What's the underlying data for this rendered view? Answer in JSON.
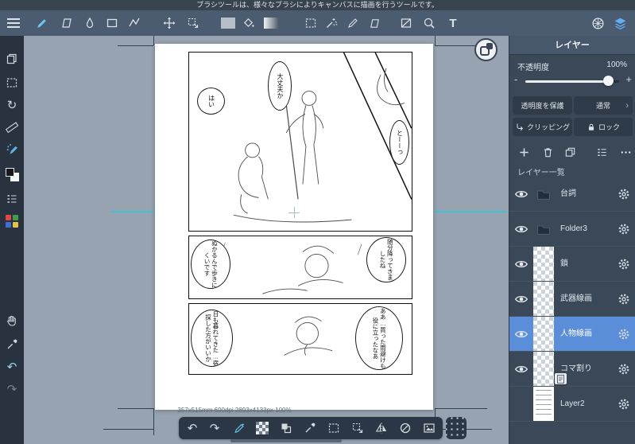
{
  "glyphs": {
    "undo": "↶",
    "redo": "↷",
    "rotate_reset": "↻",
    "chevron": "›",
    "minus": "-",
    "plus": "+",
    "text_tool": "T"
  },
  "notification": {
    "text": "ブラシツールは、様々なブラシによりキャンバスに描画を行うツールです。"
  },
  "top_toolbar": {
    "active_tool": "brush",
    "tools": [
      "menu",
      "brush",
      "eraser",
      "blend",
      "shape",
      "polyline",
      "move",
      "transform",
      "color-swatch",
      "bucket",
      "gradient",
      "select",
      "magic-wand",
      "select-pen",
      "select-eraser",
      "divide-frame",
      "zoom",
      "text",
      "network",
      "layers"
    ]
  },
  "left_toolbar": {
    "active_tool": "airbrush",
    "tools": [
      "pages",
      "select",
      "reset-view",
      "ruler",
      "airbrush",
      "fg-bg-color",
      "layer-list",
      "palette",
      "hand",
      "eyedropper",
      "undo",
      "redo"
    ]
  },
  "canvas": {
    "status_text": "357x515mm 600dpi 2893x4133px 100%",
    "bubbles": [
      {
        "text": "大丈夫か"
      },
      {
        "text": "はい"
      },
      {
        "text": "とーーっ"
      },
      {
        "text": "ぬかるんで歩きにくいです"
      },
      {
        "text": "随分降ってきましたね"
      },
      {
        "text": "日も暮れてきた…宿探した方がいいか"
      },
      {
        "text": "ああ…買った雨避けも役に立ったなあ"
      }
    ]
  },
  "bottom_toolbar": {
    "tools": [
      "undo",
      "redo",
      "stylus",
      "transparent-bg",
      "swap-squares",
      "eyedropper",
      "select-area",
      "transform",
      "flip-horizontal",
      "rotate-lock",
      "insert-image",
      "drag-handle"
    ]
  },
  "layers_panel": {
    "title": "レイヤー",
    "opacity_label": "不透明度",
    "opacity_value": "100%",
    "protect_alpha_label": "透明度を保護",
    "blend_mode_value": "通常",
    "clipping_label": "クリッピング",
    "lock_label": "ロック",
    "list_title": "レイヤー一覧",
    "layers": [
      {
        "name": "台詞",
        "type": "folder",
        "visible": true,
        "selected": false
      },
      {
        "name": "Folder3",
        "type": "folder",
        "visible": true,
        "selected": false
      },
      {
        "name": "鎖",
        "type": "raster",
        "visible": true,
        "selected": false
      },
      {
        "name": "武器線画",
        "type": "raster",
        "visible": true,
        "selected": false
      },
      {
        "name": "人物線画",
        "type": "raster",
        "visible": true,
        "selected": true
      },
      {
        "name": "コマ割り",
        "type": "raster",
        "visible": true,
        "selected": false
      },
      {
        "name": "Layer2",
        "type": "paper",
        "visible": false,
        "selected": false
      }
    ]
  }
}
